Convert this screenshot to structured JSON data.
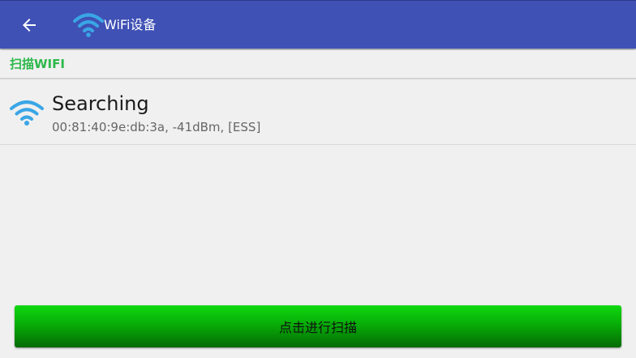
{
  "app_bar": {
    "title": "WiFi设备",
    "background": "#3f51b5",
    "back_icon": "arrow-left-icon",
    "app_icon": "wifi-icon"
  },
  "section": {
    "title": "扫描WIFI",
    "color": "#2db84b"
  },
  "wifi_list": [
    {
      "icon": "wifi-signal-icon",
      "name": "Searching",
      "detail": "00:81:40:9e:db:3a, -41dBm, [ESS]"
    }
  ],
  "scan_button": {
    "label": "点击进行扫描",
    "color": "#07a707"
  },
  "icon_color": "#3aa6e6"
}
